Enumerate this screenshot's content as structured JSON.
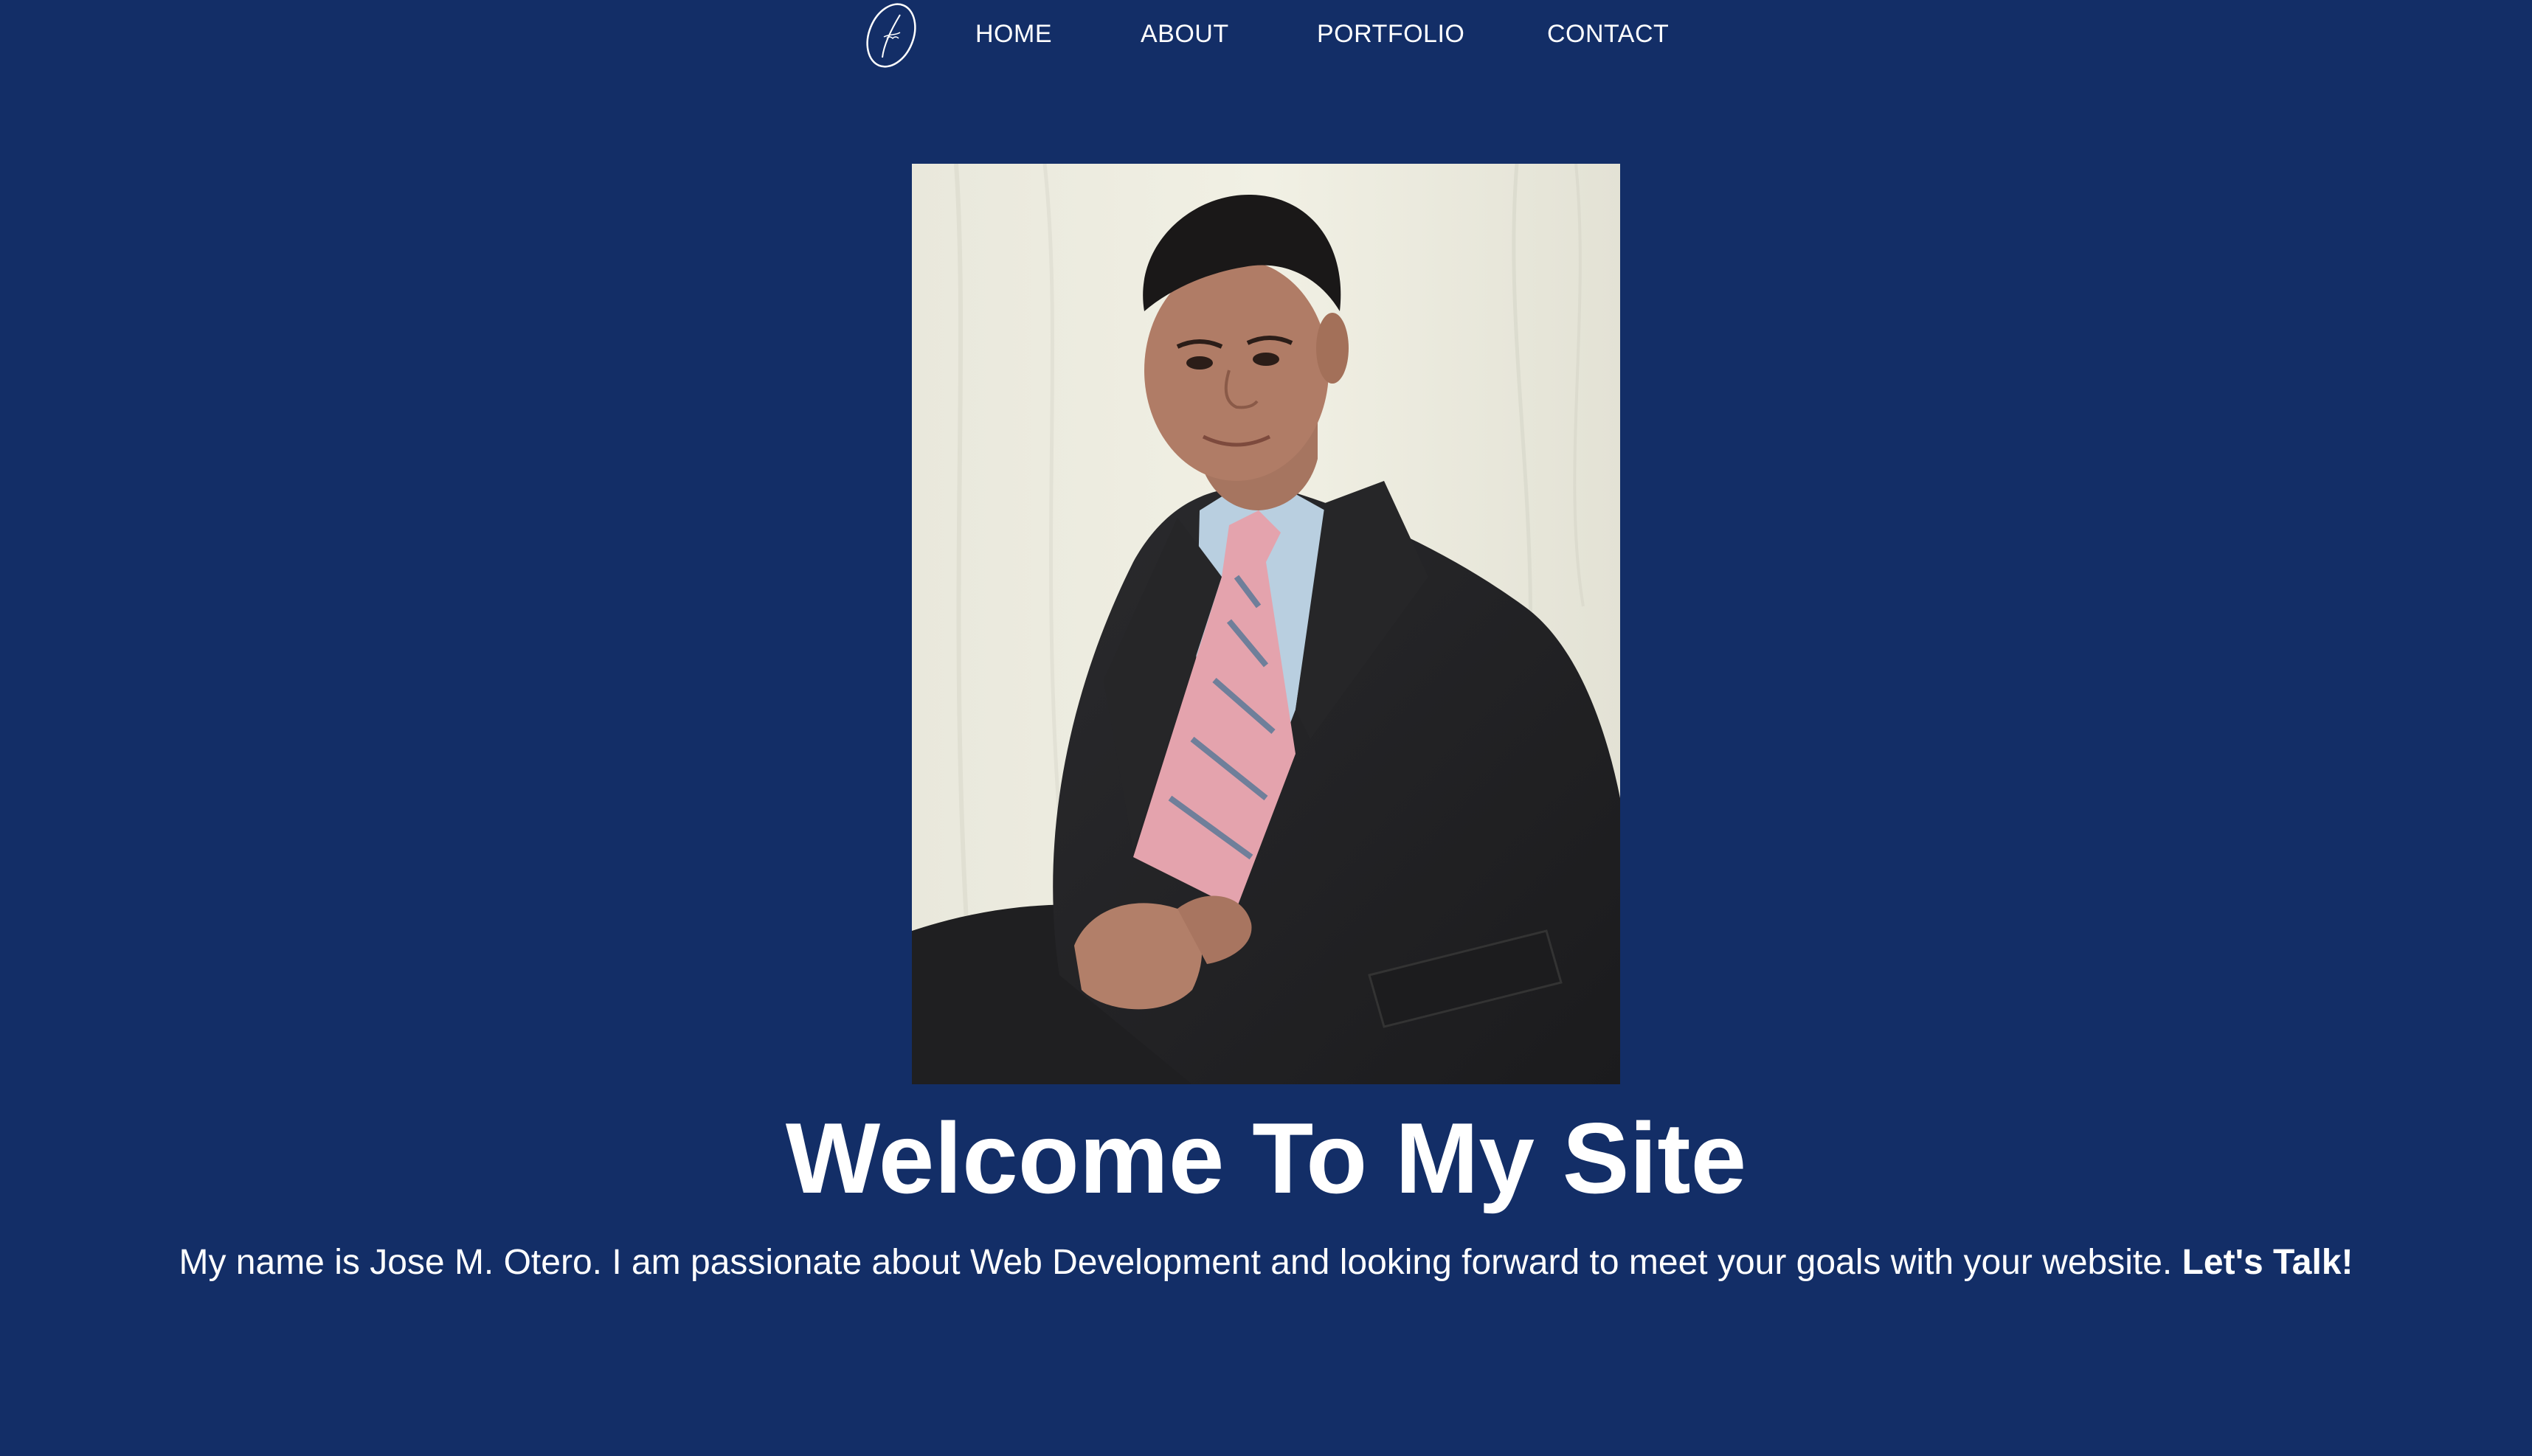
{
  "nav": {
    "logo_icon": "script-monogram-logo",
    "items": [
      {
        "label": "HOME"
      },
      {
        "label": "ABOUT"
      },
      {
        "label": "PORTFOLIO"
      },
      {
        "label": "CONTACT"
      }
    ]
  },
  "hero": {
    "photo": "portrait-photo",
    "title": "Welcome To My Site",
    "intro_text": "My name is Jose M. Otero. I am passionate about Web Development and looking forward to meet your goals with your website.",
    "cta_text": "Let's Talk!"
  },
  "colors": {
    "background": "#132e67",
    "text": "#ffffff"
  }
}
